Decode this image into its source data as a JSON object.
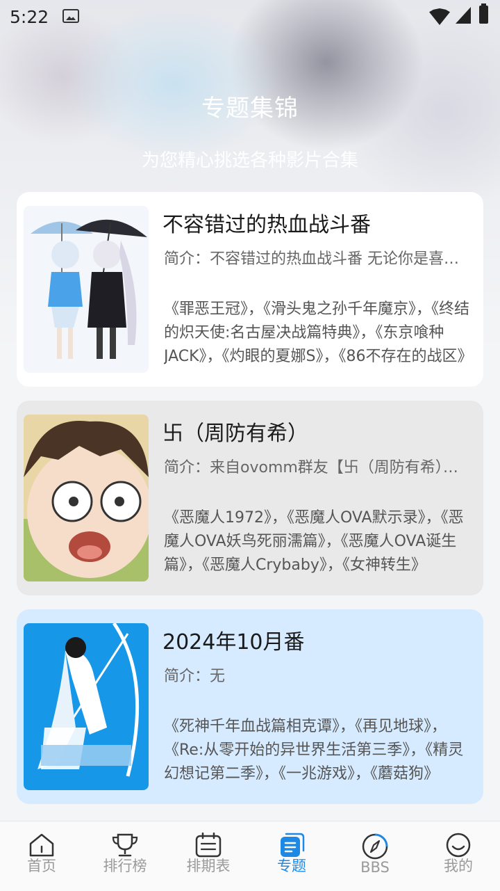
{
  "status_bar": {
    "time": "5:22"
  },
  "header": {
    "title": "专题集锦",
    "subtitle": "为您精心挑选各种影片合集"
  },
  "collections": [
    {
      "title": "不容错过的热血战斗番",
      "description": "简介：不容错过的热血战斗番 无论你是喜欢热血的战斗场面还是精彩的剧情",
      "works": "《罪恶王冠》，《滑头鬼之孙千年魔京》，《终结的炽天使:名古屋决战篇特典》，《东京喰种JACK》，《灼眼的夏娜S》，《86不存在的战区》"
    },
    {
      "title": "卐（周防有希）",
      "description": "简介：来自ovomm群友【卐（周防有希）】的推荐合集",
      "works": "《恶魔人1972》，《恶魔人OVA默示录》，《恶魔人OVA妖鸟死丽濡篇》，《恶魔人OVA诞生篇》，《恶魔人Crybaby》，《女神转生》"
    },
    {
      "title": "2024年10月番",
      "description": "简介：无",
      "works": "《死神千年血战篇相克谭》，《再见地球》，《Re:从零开始的异世界生活第三季》，《精灵幻想记第二季》，《一兆游戏》，《蘑菇狗》"
    }
  ],
  "tabs": [
    {
      "label": "首页",
      "icon": "home-icon"
    },
    {
      "label": "排行榜",
      "icon": "trophy-icon"
    },
    {
      "label": "排期表",
      "icon": "calendar-icon"
    },
    {
      "label": "专题",
      "icon": "topic-icon",
      "active": true
    },
    {
      "label": "BBS",
      "icon": "compass-icon"
    },
    {
      "label": "我的",
      "icon": "smile-icon"
    }
  ],
  "colors": {
    "accent": "#1e88e5",
    "inactive": "#9a9a9a"
  }
}
